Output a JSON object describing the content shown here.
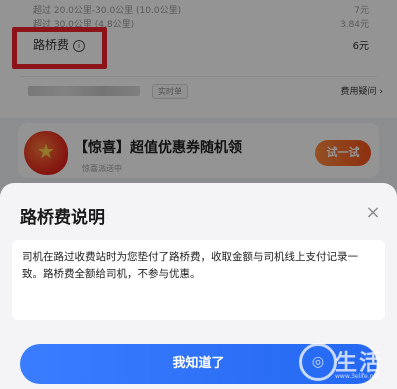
{
  "fee_breakdown": {
    "rows": [
      {
        "label": "超过 20.0公里-30.0公里 (10.0公里)",
        "amount": "7元"
      },
      {
        "label": "超过 30.0公里 (4.8公里)",
        "amount": "3.84元"
      }
    ],
    "toll": {
      "label": "路桥费",
      "info_icon": "info-circle-icon",
      "amount": "6元"
    }
  },
  "driver_row": {
    "tag": "实时单",
    "help_link": "费用疑问",
    "chevron": "›"
  },
  "promo": {
    "title": "【惊喜】超值优惠券随机领",
    "subtitle": "惊喜派送中",
    "button": "试一试"
  },
  "sheet": {
    "title": "路桥费说明",
    "close": "×",
    "message": "司机在路过收费站时为您垫付了路桥费，收取金额与司机线上支付记录一致。路桥费全额给司机，不参与优惠。",
    "confirm_button": "我知道了"
  },
  "watermark": {
    "text": "生活",
    "url": "www.3elife.net"
  },
  "colors": {
    "highlight_border": "#f2212c",
    "primary": "#2468f2",
    "promo_button": "#f3521a"
  }
}
